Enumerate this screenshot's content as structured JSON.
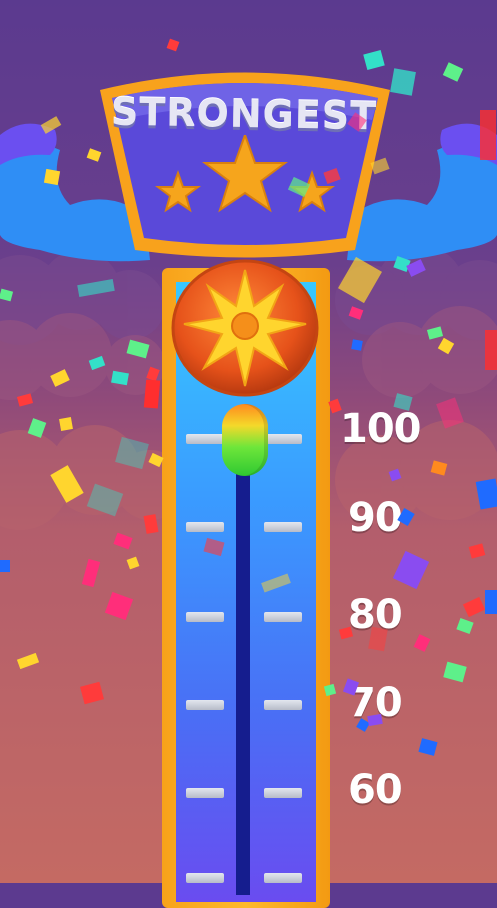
{
  "sign": {
    "title": "STRONGEST",
    "stars": 3
  },
  "meter": {
    "labels": [
      "100",
      "90",
      "80",
      "70",
      "60"
    ],
    "puck_level": 100
  },
  "colors": {
    "frame": "#f7a21a",
    "sign_fill": "#5a49d9",
    "bell": "#e8521a",
    "bell_star": "#ffd52e",
    "track": "#151d8e"
  },
  "icons": {
    "bell": "sun-burst-bell-icon",
    "muscle": "flexed-arm-icon",
    "star": "star-icon"
  }
}
